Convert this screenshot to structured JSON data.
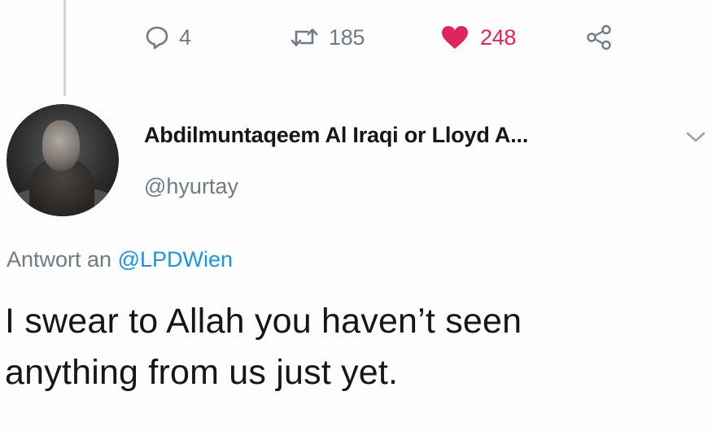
{
  "previous_tweet": {
    "actions": {
      "reply_count": "4",
      "retweet_count": "185",
      "like_count": "248"
    }
  },
  "tweet": {
    "display_name": "Abdilmuntaqeem Al Iraqi or Lloyd A...",
    "handle": "@hyurtay",
    "reply_prefix": "Antwort an",
    "reply_to": "@LPDWien",
    "text_lines": [
      "I swear to Allah you haven’t seen",
      "anything from us just yet."
    ]
  },
  "icons": {
    "reply": "reply-icon",
    "retweet": "retweet-icon",
    "like": "heart-icon",
    "share": "share-icon",
    "menu": "chevron-down-icon"
  },
  "colors": {
    "like_active": "#e0245e",
    "mention": "#1b95e0",
    "secondary_text": "#707b85",
    "primary_text": "#14171a"
  }
}
